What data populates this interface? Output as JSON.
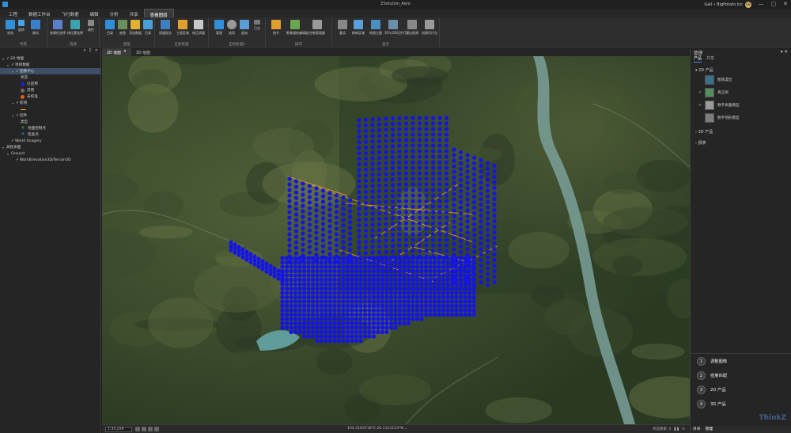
{
  "window": {
    "title": "ZSolution_Aero",
    "account": "Gail • BigPotato.Inc",
    "avatar_initials": "GB",
    "controls": [
      "—",
      "▢",
      "✕"
    ]
  },
  "menu": {
    "tabs": [
      "工程",
      "数据工作台",
      "飞行数据",
      "编辑",
      "分析",
      "共享",
      "查看图层"
    ],
    "active": 6
  },
  "ribbon": {
    "groups": [
      {
        "name": "导航",
        "buttons": [
          "浏览",
          "旋转",
          "移动",
          "缩放"
        ]
      },
      {
        "name": "选择",
        "buttons": [
          "按属性选择",
          "按位置选择",
          "属性",
          "清除"
        ]
      },
      {
        "name": "图层",
        "buttons": [
          "目录",
          "底图",
          "添加数据",
          "目录"
        ]
      },
      {
        "name": "正射处理",
        "buttons": [
          "质量报告",
          "工程区域",
          "修正质量"
        ]
      },
      {
        "name": "正射处理2",
        "buttons": [
          "管理",
          "选项",
          "起始",
          "日志",
          "报告"
        ]
      },
      {
        "name": "操作",
        "buttons": [
          "指令",
          "影像描绘编辑器",
          "控制管理器"
        ]
      },
      {
        "name": "显示",
        "buttons": [
          "重设",
          "刷新区域",
          "地图主题",
          "3D与2D同步打开",
          "导出视频",
          "创建切片包"
        ]
      }
    ]
  },
  "left_panel": {
    "controls": [
      "▾",
      "⊼",
      "✕"
    ],
    "tree": [
      {
        "level": 0,
        "label": "2D 地图",
        "checked": true,
        "chev": "▾"
      },
      {
        "level": 1,
        "label": "项目数据",
        "checked": true,
        "chev": "▾"
      },
      {
        "level": 2,
        "label": "图像中心",
        "checked": true,
        "chev": "▾",
        "selected": true
      },
      {
        "level": 3,
        "label": "状态",
        "checked": null
      },
      {
        "level": 3,
        "label": "已启用",
        "swatch": "circle",
        "color": "#1a22d8"
      },
      {
        "level": 3,
        "label": "禁用",
        "swatch": "circle",
        "color": "#6b6b6b"
      },
      {
        "level": 3,
        "label": "未校准",
        "swatch": "circle",
        "color": "#e05a1a"
      },
      {
        "level": 2,
        "label": "航线",
        "checked": true,
        "chev": "▾"
      },
      {
        "level": 3,
        "label": "",
        "swatch": "line",
        "color": "#f0a020"
      },
      {
        "level": 2,
        "label": "控件",
        "checked": true,
        "chev": "▾"
      },
      {
        "level": 3,
        "label": "类型",
        "checked": null
      },
      {
        "level": 3,
        "label": "地面控制点",
        "swatch": "plus",
        "color": "#20c050"
      },
      {
        "level": 3,
        "label": "检查点",
        "swatch": "plus",
        "color": "#2090e0"
      },
      {
        "level": 1,
        "label": "World Imagery",
        "checked": true
      },
      {
        "level": 0,
        "label": "高程表面",
        "chev": "▾"
      },
      {
        "level": 1,
        "label": "Ground",
        "chev": "▾"
      },
      {
        "level": 2,
        "label": "WorldElevation3D/Terrain3D",
        "checked": true
      }
    ]
  },
  "map_tabs": [
    {
      "label": "2D 地图",
      "active": true,
      "closable": true
    },
    {
      "label": "3D 地图",
      "active": false
    }
  ],
  "map_status": {
    "scale": "1:35,259",
    "coords": "104.2163718°E  26.1123153°N  ⌄",
    "nav_label": "所选要素: 0"
  },
  "right_panel": {
    "title": "管理",
    "tabs": [
      "产品",
      "共享"
    ],
    "sections": [
      {
        "label": "2D 产品",
        "expanded": true
      },
      {
        "label": "3D 产品",
        "expanded": false
      },
      {
        "label": "报表",
        "expanded": false
      }
    ],
    "products_2d": [
      {
        "label": "图阵漫出",
        "checked": false
      },
      {
        "label": "真正射",
        "checked": true
      },
      {
        "label": "数字表面模型",
        "checked": true
      },
      {
        "label": "数字地形模型",
        "checked": false
      }
    ],
    "steps": [
      "调整图像",
      "密度匹配",
      "2D 产品",
      "3D 产品"
    ],
    "bottom_tabs": [
      "目录",
      "管理"
    ],
    "watermark": "ThinkZ"
  },
  "colors": {
    "accent": "#3b8fe0",
    "point": "#1414e6",
    "flight_line": "#f0a020"
  }
}
